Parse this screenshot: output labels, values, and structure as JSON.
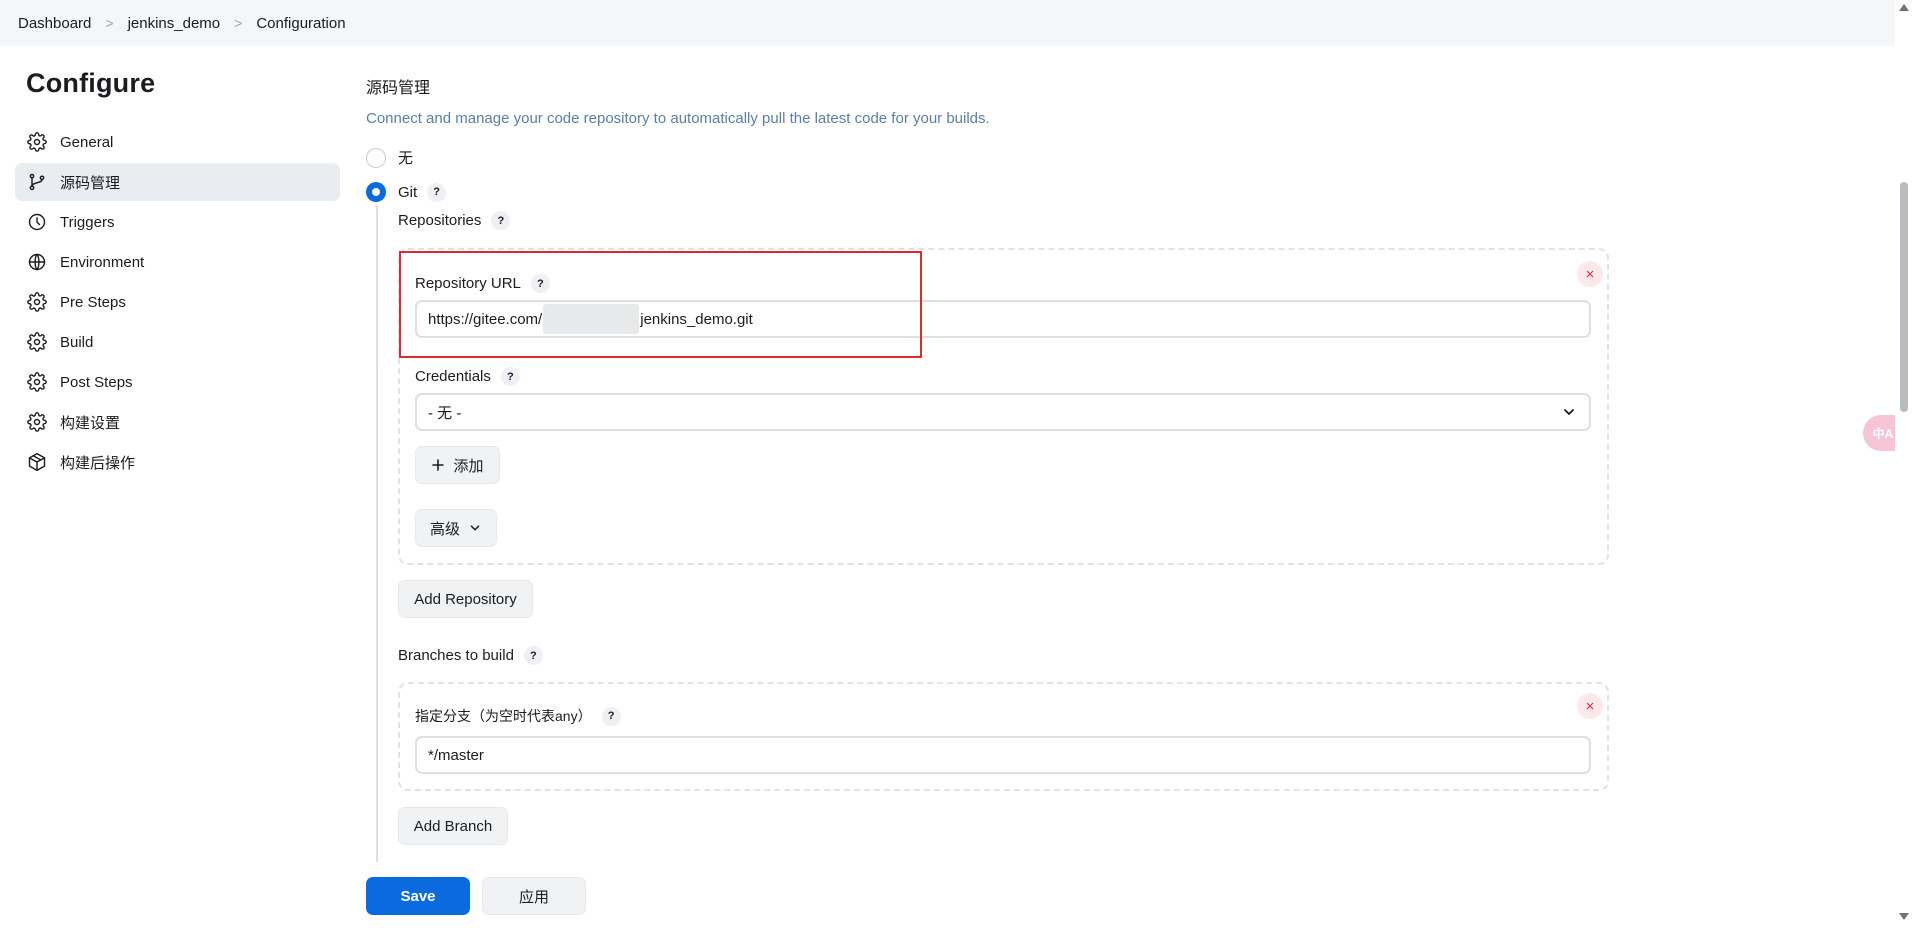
{
  "breadcrumb": {
    "items": [
      "Dashboard",
      "jenkins_demo",
      "Configuration"
    ],
    "separator": ">"
  },
  "sidebar": {
    "title": "Configure",
    "items": [
      {
        "label": "General",
        "icon": "gear-icon"
      },
      {
        "label": "源码管理",
        "icon": "git-branch-icon",
        "active": true
      },
      {
        "label": "Triggers",
        "icon": "clock-icon"
      },
      {
        "label": "Environment",
        "icon": "globe-icon"
      },
      {
        "label": "Pre Steps",
        "icon": "gear-icon"
      },
      {
        "label": "Build",
        "icon": "gear-icon"
      },
      {
        "label": "Post Steps",
        "icon": "gear-icon"
      },
      {
        "label": "构建设置",
        "icon": "gear-icon"
      },
      {
        "label": "构建后操作",
        "icon": "cube-icon"
      }
    ]
  },
  "scm": {
    "title": "源码管理",
    "description": "Connect and manage your code repository to automatically pull the latest code for your builds.",
    "option_none": "无",
    "option_git": "Git",
    "selected": "Git",
    "help_glyph": "?",
    "repositories_label": "Repositories",
    "repo_url_label": "Repository URL",
    "repo_url_prefix": "https://gitee.com/",
    "repo_url_suffix": "jenkins_demo.git",
    "credentials_label": "Credentials",
    "credentials_value": "- 无 -",
    "add_button": "添加",
    "add_button_icon": "plus-icon",
    "advanced_button": "高级",
    "add_repository_button": "Add Repository",
    "branches_label": "Branches to build",
    "branch_specifier_label": "指定分支（为空时代表any）",
    "branch_specifier_value": "*/master",
    "add_branch_button": "Add Branch",
    "close_glyph": "×"
  },
  "footer": {
    "save": "Save",
    "apply": "应用"
  },
  "colors": {
    "primary": "#0b6bde",
    "highlight": "#e0282e",
    "description": "#5b7ea8"
  },
  "translate_fab": "中A"
}
